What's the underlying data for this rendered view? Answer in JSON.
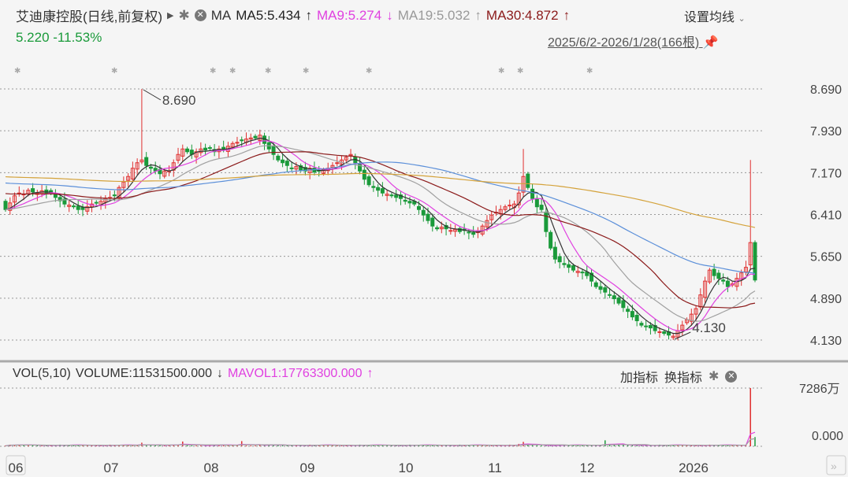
{
  "header": {
    "title": "艾迪康控股(日线,前复权)",
    "ma_label": "MA",
    "ma5": "MA5:5.434",
    "ma5_arrow": "↑",
    "ma9": "MA9:5.274",
    "ma9_arrow": "↓",
    "ma19": "MA19:5.032",
    "ma19_arrow": "↑",
    "ma30": "MA30:4.872",
    "ma30_arrow": "↑",
    "price_change": "5.220 -11.53%",
    "settings": "设置均线",
    "range": "2025/6/2-2026/1/28(166根)"
  },
  "volume_panel": {
    "label": "VOL(5,10)",
    "volume": "VOLUME:11531500.000",
    "volume_arrow": "↓",
    "mavol": "MAVOL1:17763300.000",
    "mavol_arrow": "↑",
    "add_indicator": "加指标",
    "switch_indicator": "换指标",
    "axis_top": "7286万",
    "axis_bottom": "0.000"
  },
  "colors": {
    "up": "#e03030",
    "down": "#1a9a3a",
    "ma5": "#333333",
    "ma9": "#e040e0",
    "ma19": "#a0a0a0",
    "ma30": "#8b1a1a",
    "ma60": "#5b8fd9",
    "ma120": "#d4a23a"
  },
  "chart_data": {
    "type": "candlestick",
    "price_ticks": [
      "8.690",
      "7.930",
      "7.170",
      "6.410",
      "5.650",
      "4.890",
      "4.130"
    ],
    "ylim": [
      4.13,
      8.69
    ],
    "month_labels": [
      "06",
      "07",
      "08",
      "09",
      "10",
      "11",
      "12",
      "2026"
    ],
    "annotations": [
      {
        "label": "8.690",
        "index": 30,
        "value": 8.69
      },
      {
        "label": "4.130",
        "index": 147,
        "value": 4.13
      }
    ],
    "closes": [
      6.5,
      6.62,
      6.75,
      6.8,
      6.78,
      6.85,
      6.82,
      6.8,
      6.84,
      6.8,
      6.8,
      6.72,
      6.66,
      6.6,
      6.58,
      6.55,
      6.5,
      6.5,
      6.55,
      6.6,
      6.62,
      6.65,
      6.7,
      6.72,
      6.75,
      6.9,
      7.0,
      7.1,
      7.25,
      7.35,
      7.4,
      7.3,
      7.25,
      7.2,
      7.15,
      7.2,
      7.2,
      7.35,
      7.5,
      7.6,
      7.55,
      7.5,
      7.55,
      7.6,
      7.58,
      7.62,
      7.55,
      7.6,
      7.6,
      7.65,
      7.7,
      7.72,
      7.75,
      7.78,
      7.8,
      7.8,
      7.85,
      7.7,
      7.6,
      7.5,
      7.4,
      7.35,
      7.3,
      7.25,
      7.28,
      7.22,
      7.2,
      7.25,
      7.18,
      7.2,
      7.22,
      7.25,
      7.3,
      7.35,
      7.4,
      7.45,
      7.5,
      7.35,
      7.2,
      7.05,
      6.95,
      6.9,
      6.85,
      6.8,
      6.78,
      6.75,
      6.72,
      6.7,
      6.65,
      6.62,
      6.6,
      6.5,
      6.4,
      6.3,
      6.2,
      6.15,
      6.18,
      6.15,
      6.12,
      6.14,
      6.1,
      6.12,
      6.08,
      6.05,
      6.1,
      6.2,
      6.3,
      6.4,
      6.45,
      6.5,
      6.55,
      6.58,
      6.6,
      6.8,
      7.1,
      6.9,
      6.7,
      6.55,
      6.5,
      6.1,
      5.8,
      5.6,
      5.55,
      5.5,
      5.45,
      5.4,
      5.38,
      5.35,
      5.3,
      5.2,
      5.1,
      5.05,
      5.0,
      4.95,
      4.88,
      4.8,
      4.72,
      4.65,
      4.55,
      4.48,
      4.4,
      4.38,
      4.35,
      4.3,
      4.28,
      4.25,
      4.22,
      4.2,
      4.3,
      4.4,
      4.5,
      4.6,
      4.7,
      4.95,
      5.2,
      5.4,
      5.3,
      5.25,
      5.2,
      5.1,
      5.15,
      5.25,
      5.35,
      5.45,
      5.9,
      5.22
    ],
    "special_highs": [
      {
        "index": 30,
        "value": 8.69
      },
      {
        "index": 114,
        "value": 7.6
      },
      {
        "index": 164,
        "value": 7.4
      }
    ],
    "special_lows": [
      {
        "index": 147,
        "value": 4.13
      }
    ],
    "volume_max": 72860000,
    "volume_spike": {
      "index": 164,
      "value": 72860000
    },
    "last_volume": 11531500
  }
}
